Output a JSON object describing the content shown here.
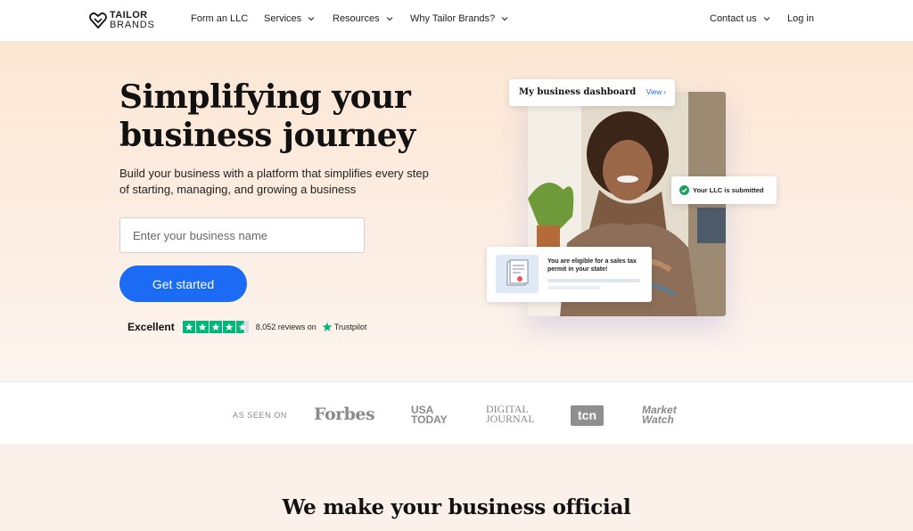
{
  "brand": {
    "name_line1": "TAILOR",
    "name_line2": "BRANDS"
  },
  "nav": {
    "items": [
      {
        "label": "Form an LLC",
        "dropdown": false
      },
      {
        "label": "Services",
        "dropdown": true
      },
      {
        "label": "Resources",
        "dropdown": true
      },
      {
        "label": "Why Tailor Brands?",
        "dropdown": true
      }
    ],
    "right": [
      {
        "label": "Contact us",
        "dropdown": true
      },
      {
        "label": "Log in",
        "dropdown": false
      }
    ]
  },
  "hero": {
    "title": "Simplifying your\nbusiness journey",
    "subtitle": "Build your business with a platform that simplifies every step of starting, managing, and growing a business",
    "input_placeholder": "Enter your business name",
    "cta_label": "Get started",
    "trustpilot": {
      "rating_label": "Excellent",
      "stars": 4.5,
      "reviews": "8,052 reviews on",
      "brand": "Trustpilot"
    }
  },
  "visual": {
    "dashboard_title": "My business dashboard",
    "dashboard_link": "View ›",
    "llc_status": "Your LLC is submitted",
    "tax_message": "You are eligible for a sales tax permit in your state!"
  },
  "press": {
    "label": "AS SEEN ON",
    "logos": {
      "forbes": "Forbes",
      "usa_line1": "USA",
      "usa_line2": "TODAY",
      "dj_line1": "DIGITAL",
      "dj_line2": "JOURNAL",
      "tcn": "tcn",
      "mw_line1": "Market",
      "mw_line2": "Watch"
    }
  },
  "section": {
    "title": "We make your business official"
  },
  "colors": {
    "accent": "#1b6bf5",
    "trustpilot_green": "#00b67a",
    "hero_bg": "#fbe6d3"
  }
}
